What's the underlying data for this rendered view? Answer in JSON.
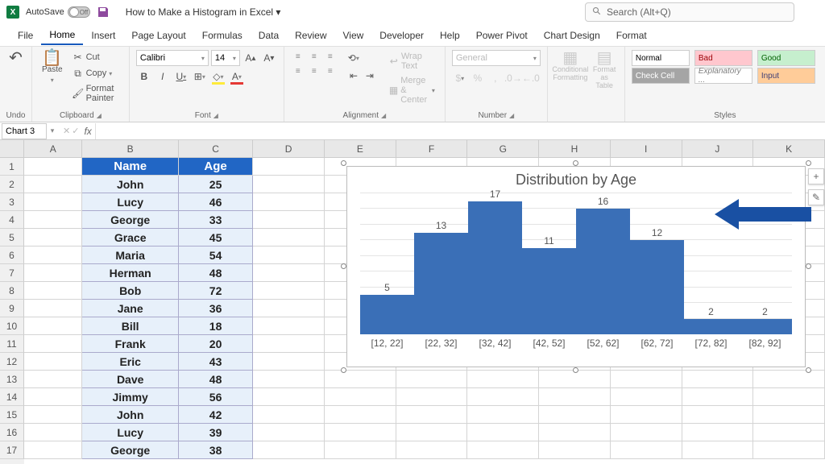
{
  "titlebar": {
    "autosave_label": "AutoSave",
    "autosave_state": "Off",
    "doc_title": "How to Make a Histogram in Excel ▾",
    "search_placeholder": "Search (Alt+Q)"
  },
  "menubar": [
    "File",
    "Home",
    "Insert",
    "Page Layout",
    "Formulas",
    "Data",
    "Review",
    "View",
    "Developer",
    "Help",
    "Power Pivot",
    "Chart Design",
    "Format"
  ],
  "menubar_active": "Home",
  "ribbon": {
    "undo": {
      "label": "Undo"
    },
    "clipboard": {
      "label": "Clipboard",
      "paste": "Paste",
      "cut": "Cut",
      "copy": "Copy",
      "painter": "Format Painter"
    },
    "font": {
      "label": "Font",
      "name": "Calibri",
      "size": "14",
      "inc": "A↑",
      "dec": "A↓"
    },
    "alignment": {
      "label": "Alignment",
      "wrap": "Wrap Text",
      "merge": "Merge & Center"
    },
    "number": {
      "label": "Number",
      "format": "General"
    },
    "cond": {
      "cond": "Conditional Formatting",
      "fat": "Format as Table"
    },
    "styles": {
      "label": "Styles",
      "cells": [
        "Normal",
        "Bad",
        "Good",
        "Check Cell",
        "Explanatory ...",
        "Input"
      ]
    }
  },
  "namebox": "Chart 3",
  "columns": [
    "A",
    "B",
    "C",
    "D",
    "E",
    "F",
    "G",
    "H",
    "I",
    "J",
    "K"
  ],
  "col_widths": [
    "wA",
    "wB",
    "wC",
    "wrest",
    "wrest",
    "wrest",
    "wrest",
    "wrest",
    "wrest",
    "wrest",
    "wrest"
  ],
  "row_count": 17,
  "table": {
    "headers": [
      "Name",
      "Age"
    ],
    "rows": [
      [
        "John",
        "25"
      ],
      [
        "Lucy",
        "46"
      ],
      [
        "George",
        "33"
      ],
      [
        "Grace",
        "45"
      ],
      [
        "Maria",
        "54"
      ],
      [
        "Herman",
        "48"
      ],
      [
        "Bob",
        "72"
      ],
      [
        "Jane",
        "36"
      ],
      [
        "Bill",
        "18"
      ],
      [
        "Frank",
        "20"
      ],
      [
        "Eric",
        "43"
      ],
      [
        "Dave",
        "48"
      ],
      [
        "Jimmy",
        "56"
      ],
      [
        "John",
        "42"
      ],
      [
        "Lucy",
        "39"
      ],
      [
        "George",
        "38"
      ]
    ]
  },
  "chart_data": {
    "type": "bar",
    "title": "Distribution by Age",
    "categories": [
      "[12, 22]",
      "[22, 32]",
      "[32, 42]",
      "[42, 52]",
      "[52, 62]",
      "[62, 72]",
      "[72, 82]",
      "[82, 92]"
    ],
    "values": [
      5,
      13,
      17,
      11,
      16,
      12,
      2,
      2
    ],
    "ylim": [
      0,
      18
    ],
    "gridlines": [
      0,
      2,
      4,
      6,
      8,
      10,
      12,
      14,
      16,
      18
    ],
    "color": "#3a6fb7"
  },
  "chart_side": {
    "plus": "+",
    "brush": "✎"
  }
}
